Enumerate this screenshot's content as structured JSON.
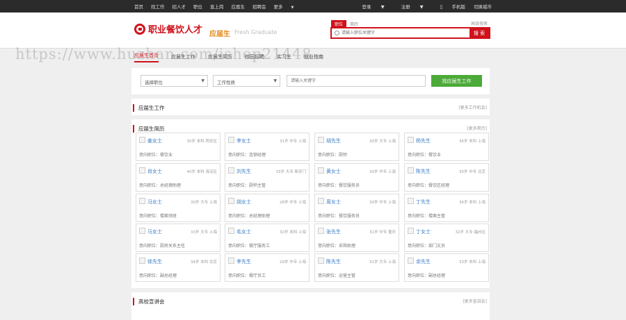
{
  "topbar": {
    "nav": [
      "首页",
      "找工作",
      "招人才",
      "职位",
      "直上岗",
      "应届生",
      "招聘会",
      "更多"
    ],
    "right": [
      "登录",
      "注册",
      "手机版",
      "切换城市"
    ]
  },
  "header": {
    "logo_text": "职业餐饮人才",
    "sub_title": "应届生",
    "sub_en": "Fresh Graduate",
    "search_tabs": [
      "职位",
      "简历"
    ],
    "advanced": "高级搜索",
    "search_placeholder": "请输入职位关键字",
    "search_button": "搜 索"
  },
  "subnav": [
    "应届生首页",
    "应届生工作",
    "应届生简历",
    "校园招聘",
    "实习生",
    "就业指南"
  ],
  "watermark": "https://www.huzhan.com/ishop21448",
  "filter": {
    "job_select": "选择职位",
    "nature_select": "工作性质",
    "keyword_placeholder": "请输入关键字",
    "find_button": "找应届生工作"
  },
  "sections": {
    "jobs": {
      "title": "应届生工作",
      "more": "[更多工作机会]"
    },
    "resumes": {
      "title": "应届生简历",
      "more": "[更多简历]"
    },
    "campus": {
      "title": "高校宣讲会",
      "more": "[更多宣讲会]"
    }
  },
  "resumes": [
    {
      "name": "姜女士",
      "info": "30岁 本科 西安区",
      "pos": "意向职位：餐饮业"
    },
    {
      "name": "李女士",
      "info": "31岁 中专 上海",
      "pos": "意向职位：连锁经理"
    },
    {
      "name": "胡先生",
      "info": "30岁 大专 上海",
      "pos": "意向职位：厨师"
    },
    {
      "name": "杨先生",
      "info": "36岁 本科 上海",
      "pos": "意向职位：餐饮业"
    },
    {
      "name": "肖女士",
      "info": "40岁 本科 海淀区",
      "pos": "意向职位：总经理助理"
    },
    {
      "name": "刘先生",
      "info": "33岁 大专 新安门",
      "pos": "意向职位：厨师主管"
    },
    {
      "name": "黄女士",
      "info": "30岁 中专 上海",
      "pos": "意向职位：餐饮服务员"
    },
    {
      "name": "陈先生",
      "info": "30岁 中专 北京",
      "pos": "意向职位：餐饮区经理"
    },
    {
      "name": "冯女士",
      "info": "30岁 大专 上海",
      "pos": "意向职位：楼面领班"
    },
    {
      "name": "胡女士",
      "info": "28岁 中专 上海",
      "pos": "意向职位：总经理助理"
    },
    {
      "name": "周女士",
      "info": "30岁 中专 上海",
      "pos": "意向职位：餐饮服务员"
    },
    {
      "name": "丁先生",
      "info": "36岁 本科 上海",
      "pos": "意向职位：楼面主管"
    },
    {
      "name": "马女士",
      "info": "33岁 大专 上海",
      "pos": "意向职位：厨房关系主任"
    },
    {
      "name": "毛女士",
      "info": "32岁 本科 上海",
      "pos": "意向职位：餐厅服务工"
    },
    {
      "name": "张先生",
      "info": "31岁 中专 重庆",
      "pos": "意向职位：采购助理"
    },
    {
      "name": "丁女士",
      "info": "32岁 大专 福州区",
      "pos": "意向职位：部门文员"
    },
    {
      "name": "徐先生",
      "info": "34岁 本科 北京",
      "pos": "意向职位：副总经理"
    },
    {
      "name": "李先生",
      "info": "29岁 中专 上海",
      "pos": "意向职位：餐厅员工"
    },
    {
      "name": "陈先生",
      "info": "31岁 大专 上海",
      "pos": "意向职位：运营主管"
    },
    {
      "name": "余先生",
      "info": "33岁 本科 上海",
      "pos": "意向职位：副总经理"
    }
  ]
}
